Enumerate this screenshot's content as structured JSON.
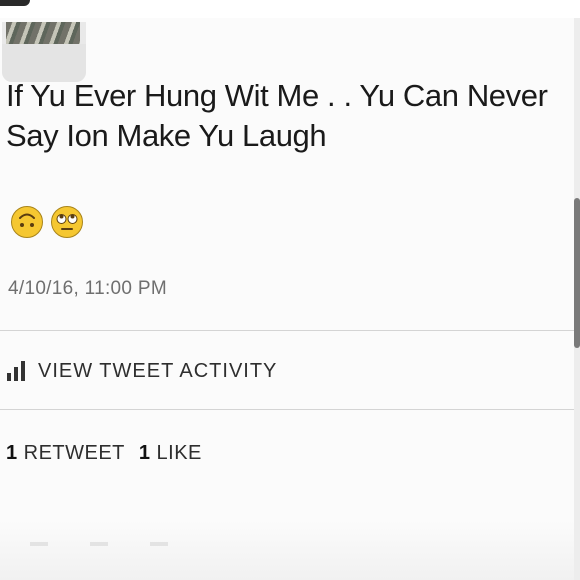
{
  "tweet": {
    "text": "If Yu Ever Hung Wit Me . . Yu Can Never Say Ion Make Yu Laugh",
    "emojis": [
      "upside-down-face-icon",
      "face-with-rolling-eyes-icon"
    ],
    "timestamp": "4/10/16, 11:00 PM"
  },
  "activity": {
    "label": "VIEW TWEET ACTIVITY",
    "icon": "bar-chart-icon"
  },
  "engagement": {
    "retweets_count": "1",
    "retweets_label": "RETWEET",
    "likes_count": "1",
    "likes_label": "LIKE"
  },
  "colors": {
    "text": "#1a1a1a",
    "muted": "#6f6f6f",
    "divider": "#d4d4d4",
    "emoji_yellow": "#f5c731"
  }
}
